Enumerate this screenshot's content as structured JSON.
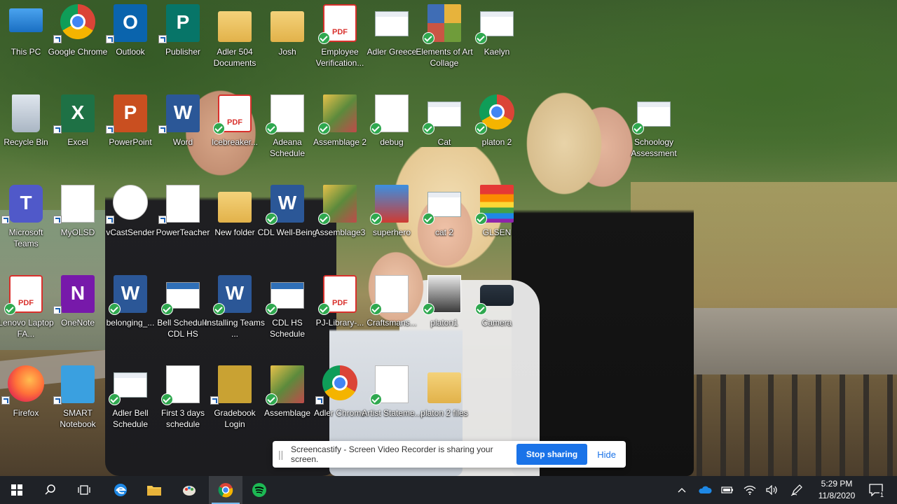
{
  "desktop": {
    "icons": [
      {
        "label": "This PC"
      },
      {
        "label": "Google Chrome"
      },
      {
        "label": "Outlook"
      },
      {
        "label": "Publisher"
      },
      {
        "label": "Adler 504 Documents"
      },
      {
        "label": "Josh"
      },
      {
        "label": "Employee Verification..."
      },
      {
        "label": "Adler Greece"
      },
      {
        "label": "Elements of Art Collage"
      },
      {
        "label": "Kaelyn"
      },
      {
        "label": "Recycle Bin"
      },
      {
        "label": "Excel"
      },
      {
        "label": "PowerPoint"
      },
      {
        "label": "Word"
      },
      {
        "label": "Icebreaker..."
      },
      {
        "label": "Adeana Schedule"
      },
      {
        "label": "Assemblage 2"
      },
      {
        "label": "debug"
      },
      {
        "label": "Cat"
      },
      {
        "label": "platon 2"
      },
      {
        "label": "Schoology Assessment"
      },
      {
        "label": "Microsoft Teams"
      },
      {
        "label": "MyOLSD"
      },
      {
        "label": "vCastSender"
      },
      {
        "label": "PowerTeacher"
      },
      {
        "label": "New folder"
      },
      {
        "label": "CDL Well-Being"
      },
      {
        "label": "Assemblage3"
      },
      {
        "label": "superhero"
      },
      {
        "label": "cat 2"
      },
      {
        "label": "GLSEN"
      },
      {
        "label": "Lenovo Laptop FA..."
      },
      {
        "label": "OneNote"
      },
      {
        "label": "belonging_..."
      },
      {
        "label": "Bell Schedule CDL HS"
      },
      {
        "label": "Installing Teams ..."
      },
      {
        "label": "CDL HS Schedule"
      },
      {
        "label": "PJ-Library-..."
      },
      {
        "label": "Craftsmans..."
      },
      {
        "label": "platon1"
      },
      {
        "label": "Camera"
      },
      {
        "label": "Firefox"
      },
      {
        "label": "SMART Notebook"
      },
      {
        "label": "Adler Bell Schedule"
      },
      {
        "label": "First 3 days schedule"
      },
      {
        "label": "Gradebook Login"
      },
      {
        "label": "Assemblage"
      },
      {
        "label": "Adler Chrome"
      },
      {
        "label": "Artist Stateme..."
      },
      {
        "label": "platon 2 files"
      }
    ]
  },
  "notification": {
    "grip": "||",
    "message": "Screencastify - Screen Video Recorder is sharing your screen.",
    "stop_label": "Stop sharing",
    "hide_label": "Hide"
  },
  "taskbar": {
    "clock_time": "5:29 PM",
    "clock_date": "11/8/2020",
    "notification_count": "1"
  },
  "colors": {
    "taskbar_bg": "#1f2227",
    "accent": "#1a73e8",
    "sync_green": "#2fa84f"
  }
}
